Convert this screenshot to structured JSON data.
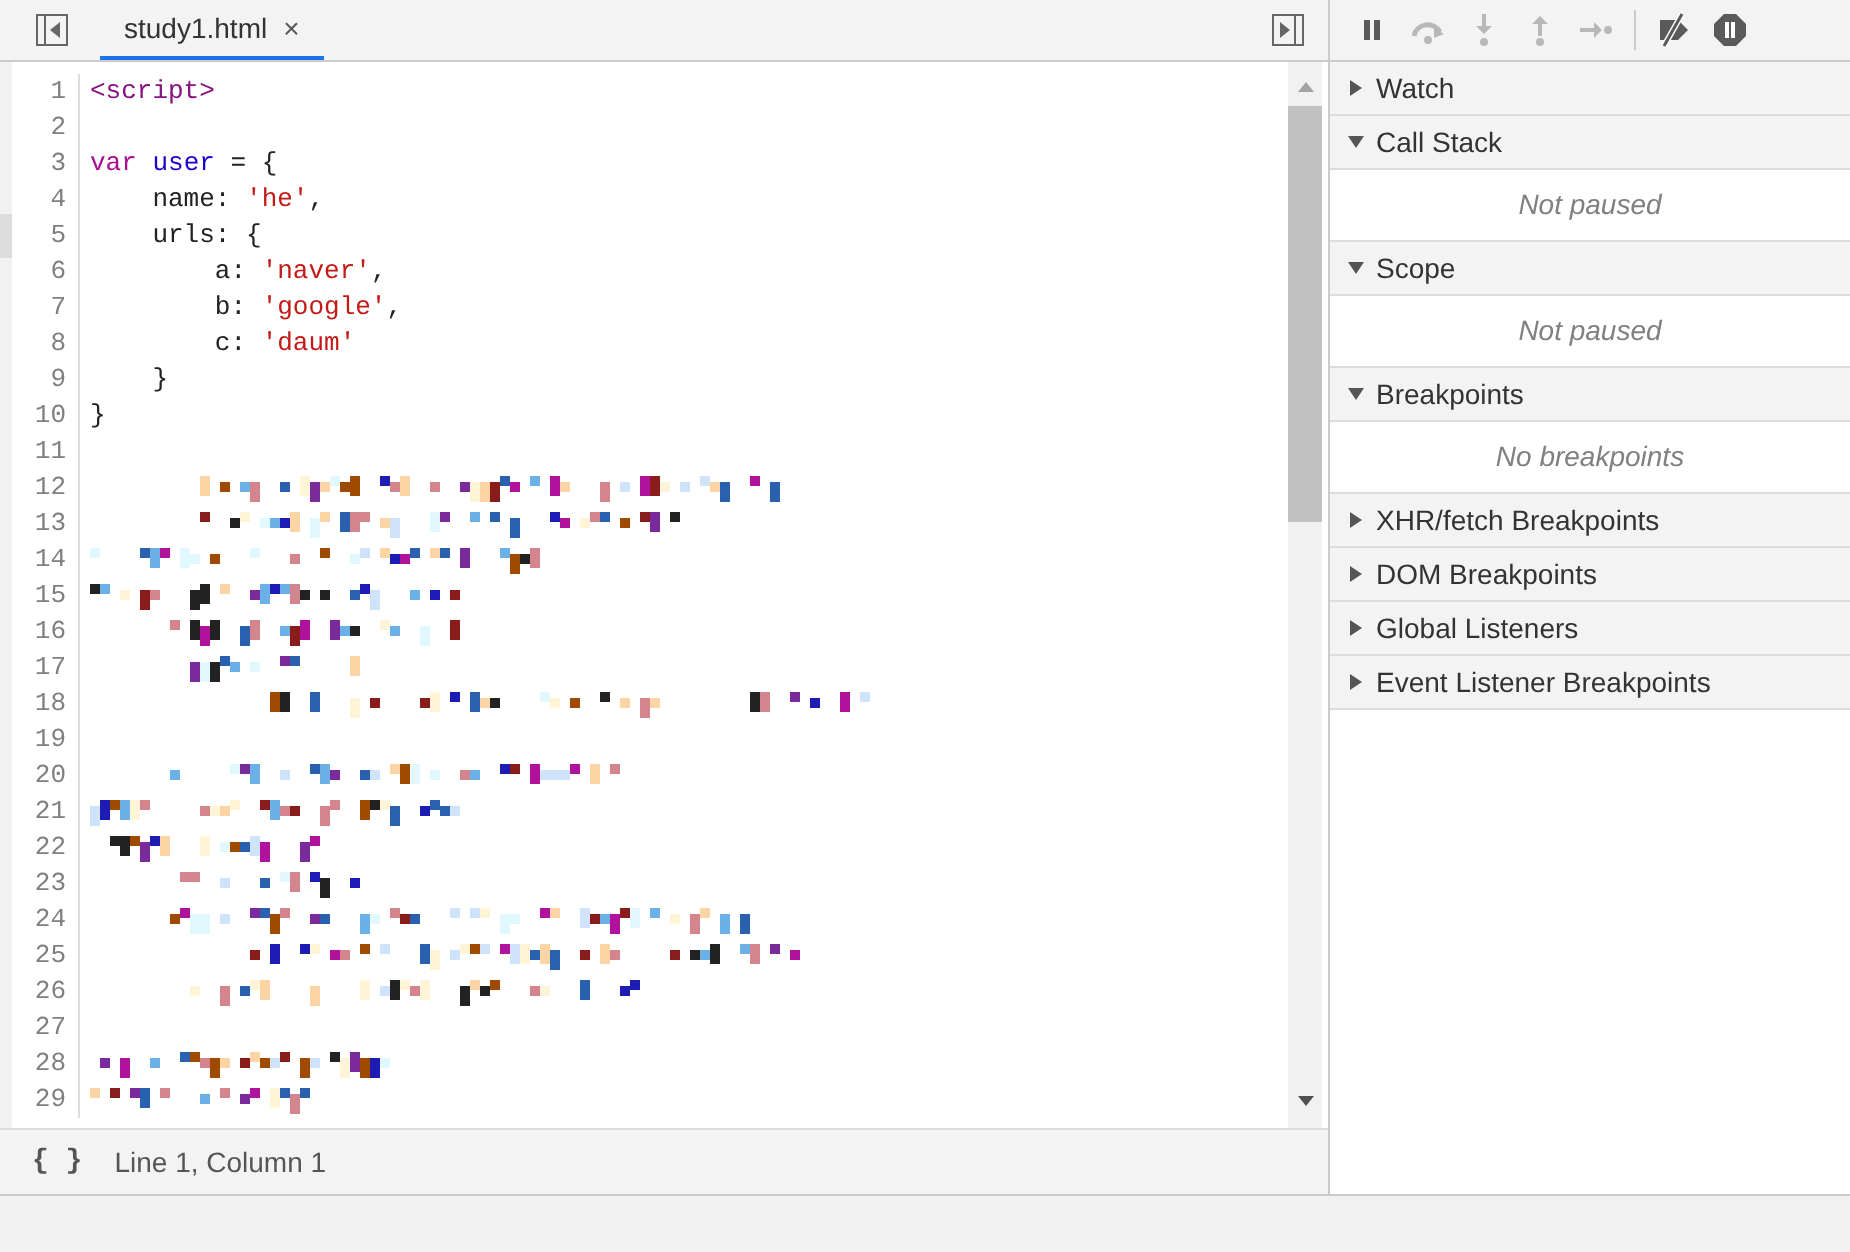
{
  "editor": {
    "tabs": [
      {
        "label": "study1.html",
        "close": "×",
        "selected": true
      }
    ],
    "lines": [
      {
        "number": "1",
        "tokens": [
          {
            "text": "<script>",
            "kind": "tag"
          }
        ]
      },
      {
        "number": "2"
      },
      {
        "number": "3",
        "tokens": [
          {
            "text": "var ",
            "kind": "keyword"
          },
          {
            "text": "user",
            "kind": "variable"
          },
          {
            "text": " = {",
            "kind": "plain"
          }
        ]
      },
      {
        "number": "4",
        "tokens": [
          {
            "text": "    name: ",
            "kind": "plain"
          },
          {
            "text": "'he'",
            "kind": "string"
          },
          {
            "text": ",",
            "kind": "plain"
          }
        ]
      },
      {
        "number": "5",
        "tokens": [
          {
            "text": "    urls: {",
            "kind": "plain"
          }
        ]
      },
      {
        "number": "6",
        "tokens": [
          {
            "text": "        a: ",
            "kind": "plain"
          },
          {
            "text": "'naver'",
            "kind": "string"
          },
          {
            "text": ",",
            "kind": "plain"
          }
        ]
      },
      {
        "number": "7",
        "tokens": [
          {
            "text": "        b: ",
            "kind": "plain"
          },
          {
            "text": "'google'",
            "kind": "string"
          },
          {
            "text": ",",
            "kind": "plain"
          }
        ]
      },
      {
        "number": "8",
        "tokens": [
          {
            "text": "        c: ",
            "kind": "plain"
          },
          {
            "text": "'daum'",
            "kind": "string"
          }
        ]
      },
      {
        "number": "9",
        "tokens": [
          {
            "text": "    }",
            "kind": "plain"
          }
        ]
      },
      {
        "number": "10",
        "tokens": [
          {
            "text": "}",
            "kind": "plain"
          }
        ]
      },
      {
        "number": "11"
      },
      {
        "number": "12",
        "kind": "redacted"
      },
      {
        "number": "13",
        "kind": "redacted"
      },
      {
        "number": "14",
        "kind": "redacted"
      },
      {
        "number": "15",
        "kind": "redacted"
      },
      {
        "number": "16",
        "kind": "redacted"
      },
      {
        "number": "17",
        "kind": "redacted"
      },
      {
        "number": "18",
        "kind": "redacted"
      },
      {
        "number": "19"
      },
      {
        "number": "20",
        "kind": "redacted"
      },
      {
        "number": "21",
        "kind": "redacted"
      },
      {
        "number": "22",
        "kind": "redacted"
      },
      {
        "number": "23",
        "kind": "redacted"
      },
      {
        "number": "24",
        "kind": "redacted"
      },
      {
        "number": "25",
        "kind": "redacted"
      },
      {
        "number": "26",
        "kind": "redacted"
      },
      {
        "number": "27"
      },
      {
        "number": "28",
        "kind": "redacted"
      },
      {
        "number": "29",
        "kind": "redacted"
      }
    ],
    "status_bar": {
      "format_button": "{ }",
      "position": "Line 1, Column 1"
    }
  },
  "debugger": {
    "toolbar": [
      {
        "kind": "pause",
        "disabled": false
      },
      {
        "kind": "step-over",
        "disabled": true
      },
      {
        "kind": "step-into",
        "disabled": true
      },
      {
        "kind": "step-out",
        "disabled": true
      },
      {
        "kind": "step",
        "disabled": true
      },
      {
        "kind": "deactivate-breakpoints",
        "disabled": false
      },
      {
        "kind": "pause-on-exceptions",
        "disabled": false
      }
    ],
    "sections": [
      {
        "title": "Watch",
        "expanded": false
      },
      {
        "title": "Call Stack",
        "expanded": true,
        "message": "Not paused"
      },
      {
        "title": "Scope",
        "expanded": true,
        "message": "Not paused"
      },
      {
        "title": "Breakpoints",
        "expanded": true,
        "message": "No breakpoints"
      },
      {
        "title": "XHR/fetch Breakpoints",
        "expanded": false
      },
      {
        "title": "DOM Breakpoints",
        "expanded": false
      },
      {
        "title": "Global Listeners",
        "expanded": false
      },
      {
        "title": "Event Listener Breakpoints",
        "expanded": false
      }
    ]
  }
}
